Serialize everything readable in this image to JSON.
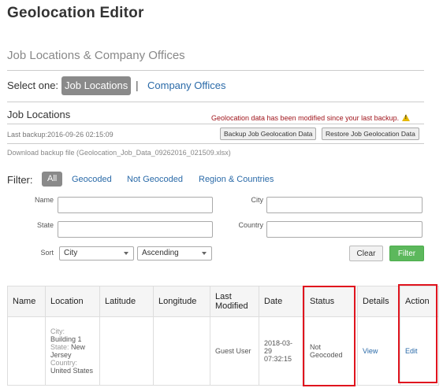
{
  "page": {
    "title": "Geolocation Editor",
    "subtitle": "Job Locations & Company Offices"
  },
  "selector": {
    "label": "Select one:",
    "separator": "|",
    "active": "Job Locations",
    "other": "Company Offices"
  },
  "section": {
    "title": "Job Locations",
    "warning": "Geolocation data has been modified since your last backup.",
    "last_backup": "Last backup:2016-09-26 02:15:09",
    "backup_button": "Backup Job Geolocation Data",
    "restore_button": "Restore Job Geolocation Data",
    "download_text": "Download backup file (Geolocation_Job_Data_09262016_021509.xlsx)"
  },
  "filter": {
    "label": "Filter:",
    "tabs": [
      "All",
      "Geocoded",
      "Not Geocoded",
      "Region & Countries"
    ],
    "fields": {
      "name": "Name",
      "city": "City",
      "state": "State",
      "country": "Country",
      "sort": "Sort"
    },
    "sort_by": "City",
    "sort_order": "Ascending",
    "clear": "Clear",
    "apply": "Filter"
  },
  "table": {
    "headers": [
      "Name",
      "Location",
      "Latitude",
      "Longitude",
      "Last Modified",
      "Date",
      "Status",
      "Details",
      "Action"
    ],
    "rows": [
      {
        "name": "",
        "city_label": "City:",
        "city": "Building 1",
        "state_label": "State:",
        "state": "New Jersey",
        "country_label": "Country:",
        "country": "United States",
        "latitude": "",
        "longitude": "",
        "last_modified": "Guest User",
        "date": "2018-03-29 07:32:15",
        "status": "Not Geocoded",
        "details": "View",
        "action": "Edit"
      }
    ]
  },
  "colors": {
    "highlight": "#e0141e",
    "link": "#2a6aa8",
    "warning": "#a0161d",
    "filter_button": "#5cb85c"
  }
}
